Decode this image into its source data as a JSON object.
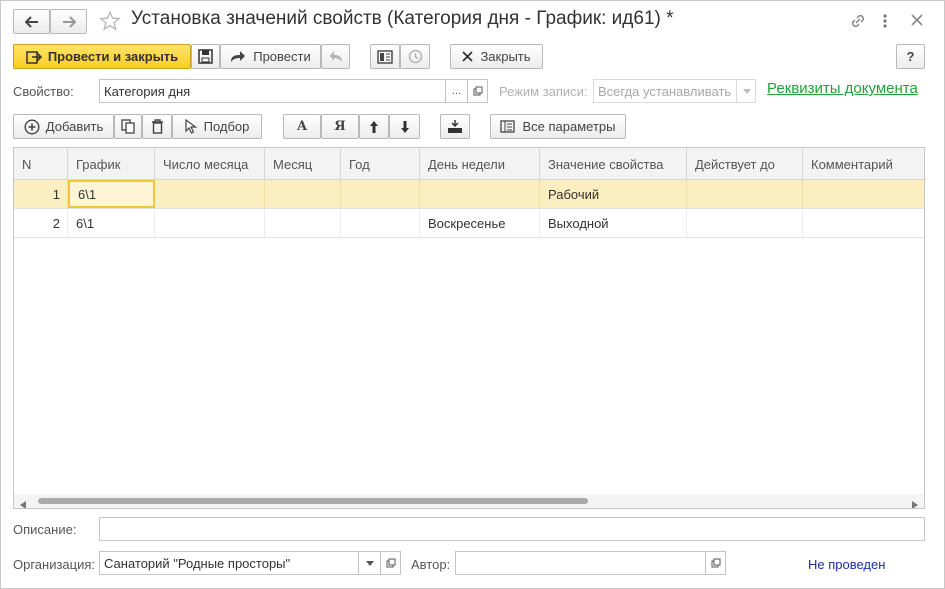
{
  "window": {
    "title": "Установка значений свойств (Категория дня - График: ид61) *"
  },
  "toolbar": {
    "post_and_close_label": "Провести и закрыть",
    "post_label": "Провести",
    "close_label": "Закрыть",
    "help_label": "?"
  },
  "property": {
    "label": "Свойство:",
    "value": "Категория дня",
    "select_btn": "..."
  },
  "write_mode": {
    "label": "Режим записи:",
    "value": "Всегда устанавливать"
  },
  "doc_requisites_link": "Реквизиты документа",
  "table_toolbar": {
    "add_label": "Добавить",
    "selection_label": "Подбор",
    "font_a_label": "А",
    "font_ya_label": "Я",
    "all_params_label": "Все параметры"
  },
  "table": {
    "columns": [
      "N",
      "График",
      "Число месяца",
      "Месяц",
      "Год",
      "День недели",
      "Значение свойства",
      "Действует до",
      "Комментарий"
    ],
    "rows": [
      {
        "n": "1",
        "schedule": "6\\1",
        "day_of_month": "",
        "month": "",
        "year": "",
        "weekday": "",
        "value": "Рабочий",
        "valid_until": "",
        "comment": ""
      },
      {
        "n": "2",
        "schedule": "6\\1",
        "day_of_month": "",
        "month": "",
        "year": "",
        "weekday": "Воскресенье",
        "value": "Выходной",
        "valid_until": "",
        "comment": ""
      }
    ]
  },
  "description": {
    "label": "Описание:",
    "value": ""
  },
  "organization": {
    "label": "Организация:",
    "value": "Санаторий \"Родные просторы\""
  },
  "author": {
    "label": "Автор:",
    "value": ""
  },
  "status_text": "Не проведен",
  "colors": {
    "primary_button": "#f7cf23",
    "selected_row": "#fbeec0",
    "link_green": "#21a13b",
    "status_blue": "#1a2fa3"
  },
  "icons": [
    "back-arrow-icon",
    "forward-arrow-icon",
    "star-icon",
    "link-icon",
    "more-icon",
    "close-icon",
    "post-icon",
    "save-icon",
    "undo-icon",
    "structure-icon",
    "history-icon",
    "x-icon",
    "add-icon",
    "copy-icon",
    "delete-icon",
    "cursor-icon",
    "up-arrow-icon",
    "down-arrow-icon",
    "fill-icon",
    "params-icon"
  ]
}
